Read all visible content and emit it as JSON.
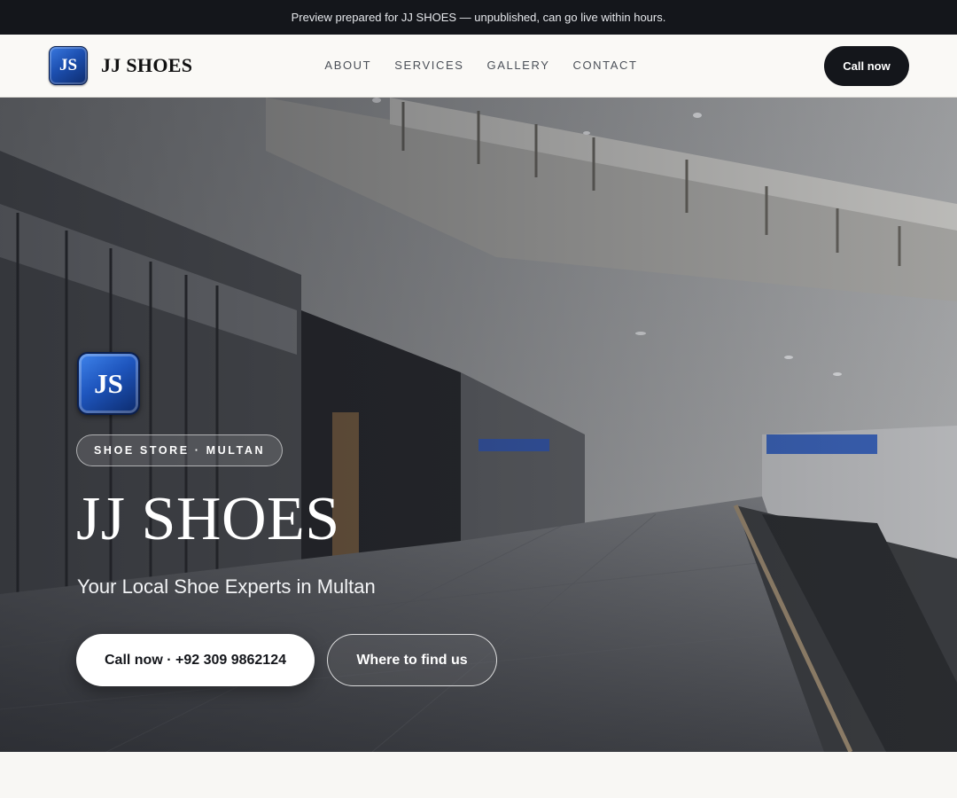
{
  "preview_banner": {
    "text": "Preview prepared for JJ SHOES — unpublished, can go live within hours."
  },
  "header": {
    "logo_initials": "JS",
    "brand_name": "JJ SHOES",
    "nav": [
      {
        "label": "ABOUT"
      },
      {
        "label": "SERVICES"
      },
      {
        "label": "GALLERY"
      },
      {
        "label": "CONTACT"
      }
    ],
    "cta_label": "Call now"
  },
  "hero": {
    "logo_initials": "JS",
    "tag": "SHOE STORE · MULTAN",
    "title": "JJ SHOES",
    "subtitle": "Your Local Shoe Experts in Multan",
    "primary_button": "Call now · +92 309 9862124",
    "secondary_button": "Where to find us"
  },
  "colors": {
    "banner_bg": "#14161b",
    "header_bg": "#faf9f6",
    "cta_dark": "#14161b",
    "logo_blue": "#1c4fb0",
    "page_bg": "#f8f7f4"
  },
  "icons": {
    "logo": "js-monogram-badge"
  }
}
